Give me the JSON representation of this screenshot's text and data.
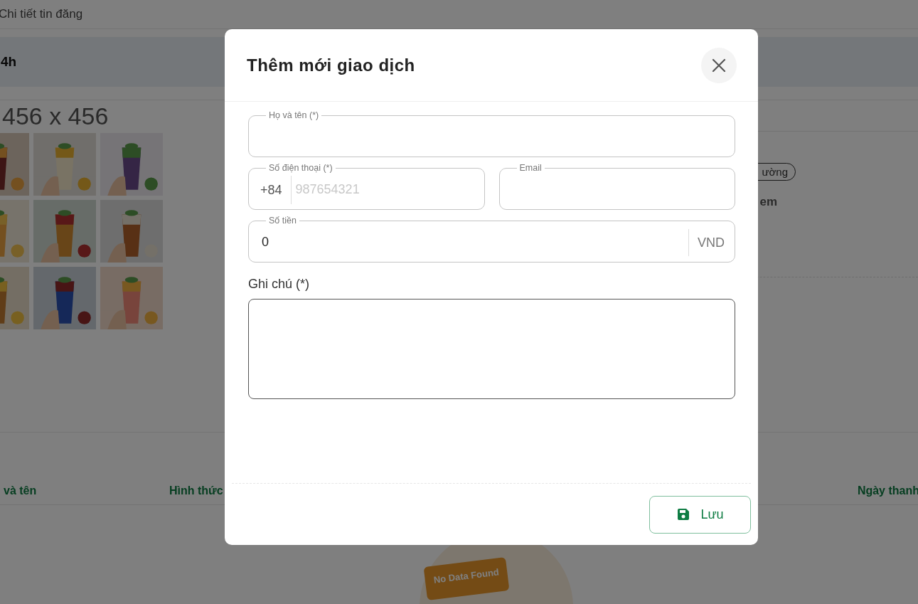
{
  "background": {
    "breadcrumb": "Chi tiết tin đăng",
    "banner": "4h",
    "image_size": "456 x 456",
    "tag": "ường",
    "link_text": "em",
    "table": {
      "columns": [
        "và tên",
        "Hình thức",
        "Ngày thanh"
      ]
    },
    "empty_state": "No Data Found"
  },
  "dialog": {
    "title": "Thêm mới giao dịch",
    "rows": [
      [
        {
          "kind": "text",
          "label": "Họ và tên (*)"
        }
      ],
      [
        {
          "kind": "phone",
          "label": "Số điện thoại (*)",
          "prefix": "+84",
          "placeholder": "987654321"
        },
        {
          "kind": "text",
          "label": "Email"
        }
      ],
      [
        {
          "kind": "money",
          "label": "Số tiền",
          "value": "0",
          "suffix": "VND"
        }
      ]
    ],
    "note": {
      "label": "Ghi chú (*)"
    },
    "save_button": {
      "label": "Lưu"
    }
  }
}
